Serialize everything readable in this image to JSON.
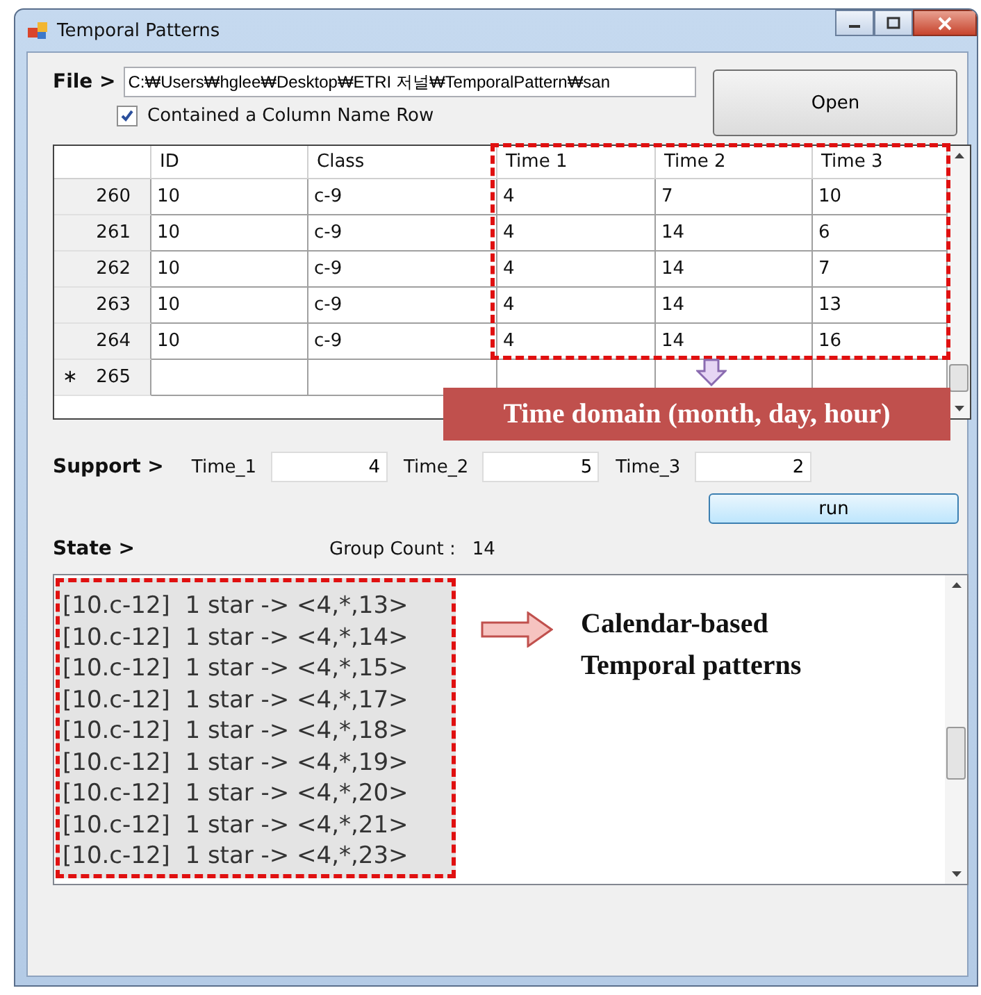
{
  "window": {
    "title": "Temporal Patterns"
  },
  "file": {
    "label": "File >",
    "path": "C:₩Users₩hglee₩Desktop₩ETRI 저널₩TemporalPattern₩san",
    "open_button": "Open",
    "header_checkbox": {
      "label": "Contained a Column Name Row",
      "checked": true
    }
  },
  "table": {
    "columns": [
      "ID",
      "Class",
      "Time 1",
      "Time 2",
      "Time 3"
    ],
    "rows": [
      {
        "number": "260",
        "cells": [
          "10",
          "c-9",
          "4",
          "7",
          "10"
        ]
      },
      {
        "number": "261",
        "cells": [
          "10",
          "c-9",
          "4",
          "14",
          "6"
        ]
      },
      {
        "number": "262",
        "cells": [
          "10",
          "c-9",
          "4",
          "14",
          "7"
        ]
      },
      {
        "number": "263",
        "cells": [
          "10",
          "c-9",
          "4",
          "14",
          "13"
        ]
      },
      {
        "number": "264",
        "cells": [
          "10",
          "c-9",
          "4",
          "14",
          "16"
        ]
      },
      {
        "number": "265",
        "new_marker": "∗",
        "cells": [
          "",
          "",
          "",
          "",
          ""
        ]
      }
    ]
  },
  "table_annotation": "Time domain (month, day, hour)",
  "support": {
    "label": "Support >",
    "fields": [
      {
        "label": "Time_1",
        "value": "4"
      },
      {
        "label": "Time_2",
        "value": "5"
      },
      {
        "label": "Time_3",
        "value": "2"
      }
    ],
    "run_button": "run"
  },
  "state": {
    "label": "State >",
    "group_count_label": "Group Count :",
    "group_count": "14"
  },
  "output_lines": [
    "[10.c-12]  1 star -> <4,*,13>",
    "[10.c-12]  1 star -> <4,*,14>",
    "[10.c-12]  1 star -> <4,*,15>",
    "[10.c-12]  1 star -> <4,*,17>",
    "[10.c-12]  1 star -> <4,*,18>",
    "[10.c-12]  1 star -> <4,*,19>",
    "[10.c-12]  1 star -> <4,*,20>",
    "[10.c-12]  1 star -> <4,*,21>",
    "[10.c-12]  1 star -> <4,*,23>"
  ],
  "output_annotation": [
    "Calendar-based",
    "Temporal patterns"
  ]
}
